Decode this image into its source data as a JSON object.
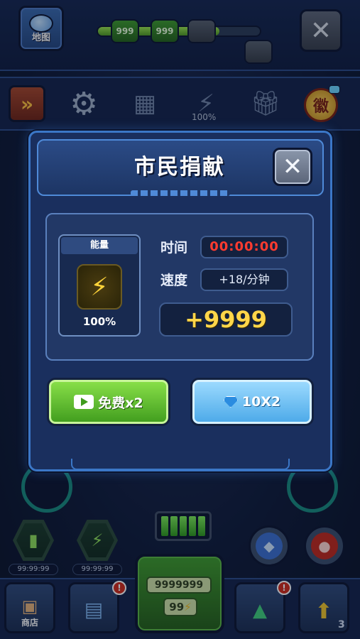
{
  "top": {
    "map_label": "地图",
    "resources": [
      "999",
      "999"
    ],
    "resource_fill": 0.75
  },
  "toolbar": {
    "fast_forward_glyph": "»",
    "energy_percent": "100%",
    "medal_glyph": "徽"
  },
  "background": {
    "timer_left": "99:99:99",
    "timer_right": "99:99:99",
    "battery_cells": 5,
    "shop_label": "商店",
    "badge_count": "!",
    "main_count": "9999999",
    "main_energy": "99",
    "upgrade_level": "3"
  },
  "dialog": {
    "title": "市民捐献",
    "energy_card_title": "能量",
    "energy_percent": "100%",
    "time_label": "时间",
    "time_value": "00:00:00",
    "speed_label": "速度",
    "speed_value": "+18/分钟",
    "reward_value": "+9999",
    "free_button_label": "免费x2",
    "gem_button_label": "10X2"
  },
  "colors": {
    "accent_blue": "#3b77c7",
    "timer_red": "#ff3b2f",
    "reward_gold": "#ffd64a",
    "free_green": "#6cc83a",
    "gem_blue": "#6ec0f5"
  },
  "icons": {
    "map": "globe-icon",
    "settings": "gear-icon",
    "close": "close-icon",
    "energy": "lightning-icon",
    "video": "video-icon",
    "gem": "diamond-icon"
  }
}
